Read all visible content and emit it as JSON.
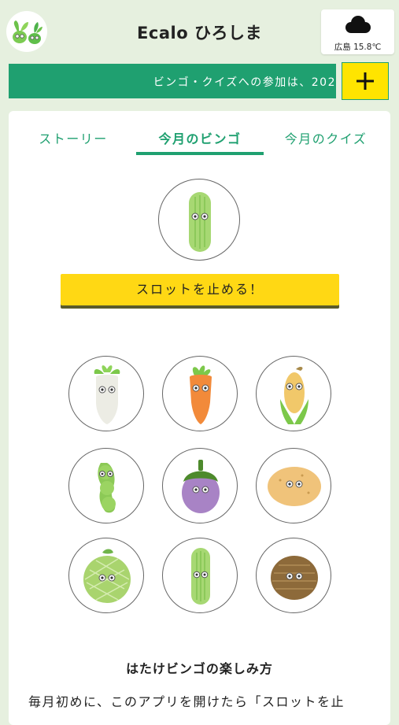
{
  "header": {
    "title": "Ecalo ひろしま",
    "logo_icon": "sprout-mascots-logo",
    "weather": {
      "icon": "cloud-icon",
      "text": "広島 15.8℃"
    }
  },
  "banner": {
    "text": "ビンゴ・クイズへの参加は、202"
  },
  "add_button": {
    "icon": "plus-icon"
  },
  "tabs": [
    {
      "label": "ストーリー",
      "active": false
    },
    {
      "label": "今月のビンゴ",
      "active": true
    },
    {
      "label": "今月のクイズ",
      "active": false
    }
  ],
  "slot": {
    "current": "cucumber"
  },
  "stop_button": {
    "label": "スロットを止める！"
  },
  "bingo_grid": [
    [
      "daikon",
      "carrot",
      "corn"
    ],
    [
      "edamame",
      "eggplant",
      "potato"
    ],
    [
      "melon",
      "cucumber",
      "taro"
    ]
  ],
  "howto": {
    "title": "はたけビンゴの楽しみ方",
    "text": "毎月初めに、このアプリを開けたら「スロットを止"
  },
  "colors": {
    "accent": "#1fa070",
    "background": "#e6f0df",
    "button": "#ffd814"
  }
}
